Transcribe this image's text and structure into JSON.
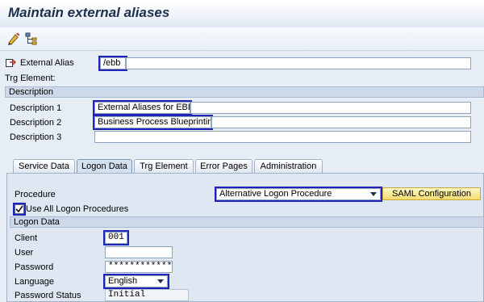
{
  "title": "Maintain external aliases",
  "toolbar": {
    "icons": [
      "edit-icon",
      "hierarchy-icon"
    ]
  },
  "header": {
    "external_alias_label": "External Alias",
    "external_alias_value": "/ebb",
    "trg_element_label": "Trg Element:"
  },
  "description": {
    "section_title": "Description",
    "desc1_label": "Description 1",
    "desc1_value": "External Aliases for EBB",
    "desc2_label": "Description 2",
    "desc2_value": "Business Process Blueprinting",
    "desc3_label": "Description 3",
    "desc3_value": ""
  },
  "tabs": [
    {
      "label": "Service Data",
      "active": false
    },
    {
      "label": "Logon Data",
      "active": true
    },
    {
      "label": "Trg Element",
      "active": false
    },
    {
      "label": "Error Pages",
      "active": false
    },
    {
      "label": "Administration",
      "active": false
    }
  ],
  "logon": {
    "procedure_label": "Procedure",
    "procedure_value": "Alternative Logon Procedure",
    "saml_button": "SAML Configuration",
    "use_all_label": "Use All Logon Procedures",
    "use_all_checked": true,
    "section_title": "Logon Data",
    "client_label": "Client",
    "client_value": "001",
    "user_label": "User",
    "user_value": "",
    "password_label": "Password",
    "password_value": "*************",
    "language_label": "Language",
    "language_value": "English",
    "password_status_label": "Password Status",
    "password_status_value": "Initial"
  },
  "colors": {
    "highlight": "#1f23b8",
    "button": "#f4dd6e",
    "section": "#cdd9e8"
  }
}
